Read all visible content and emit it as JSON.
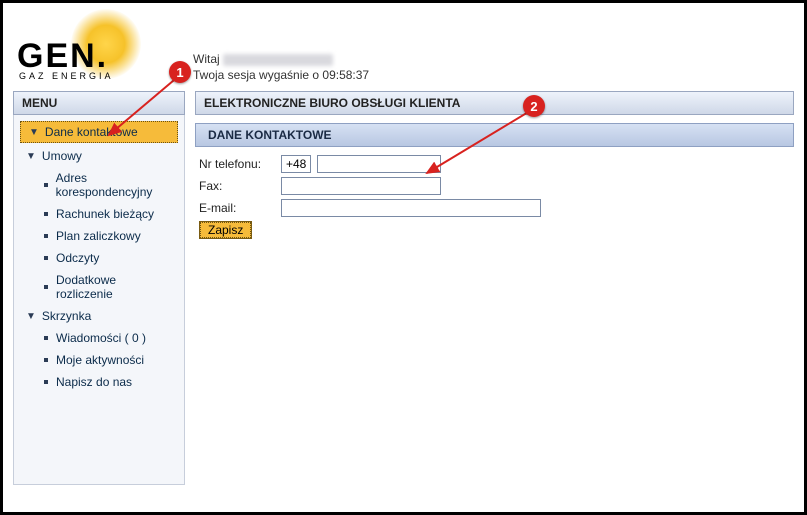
{
  "logo": {
    "text": "GEN.",
    "subtitle": "GAZ ENERGIA"
  },
  "welcome": {
    "greeting_prefix": "Witaj",
    "session_text": "Twoja sesja wygaśnie o 09:58:37"
  },
  "sidebar": {
    "title": "MENU",
    "items": {
      "dane_kontaktowe": "Dane kontaktowe",
      "umowy": "Umowy",
      "umowy_children": {
        "adres": "Adres korespondencyjny",
        "rachunek": "Rachunek bieżący",
        "plan": "Plan zaliczkowy",
        "odczyty": "Odczyty",
        "dodatkowe": "Dodatkowe rozliczenie"
      },
      "skrzynka": "Skrzynka",
      "skrzynka_children": {
        "wiadomosci": "Wiadomości ( 0 )",
        "aktywnosci": "Moje aktywności",
        "napisz": "Napisz do nas"
      }
    }
  },
  "main": {
    "title": "ELEKTRONICZNE BIURO OBSŁUGI KLIENTA",
    "section_title": "DANE KONTAKTOWE",
    "form": {
      "phone_label": "Nr telefonu:",
      "phone_prefix": "+48",
      "phone_value": "",
      "fax_label": "Fax:",
      "fax_value": "",
      "email_label": "E-mail:",
      "email_value": "",
      "save_label": "Zapisz"
    }
  },
  "callouts": {
    "c1": "1",
    "c2": "2"
  }
}
